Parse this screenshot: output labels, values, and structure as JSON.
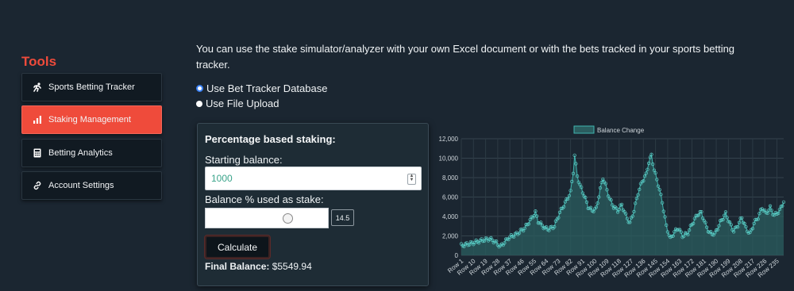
{
  "sidebar": {
    "title": "Tools",
    "items": [
      {
        "label": "Sports Betting Tracker",
        "icon": "running-icon",
        "active": false
      },
      {
        "label": "Staking Management",
        "icon": "bar-chart-icon",
        "active": true
      },
      {
        "label": "Betting Analytics",
        "icon": "calculator-icon",
        "active": false
      },
      {
        "label": "Account Settings",
        "icon": "link-icon",
        "active": false
      }
    ]
  },
  "main": {
    "intro": "You can use the stake simulator/analyzer with your own Excel document or with the bets tracked in your sports betting tracker.",
    "options": [
      {
        "label": "Use Bet Tracker Database",
        "checked": true
      },
      {
        "label": "Use File Upload",
        "checked": false
      }
    ],
    "panel": {
      "title": "Percentage based staking:",
      "starting_label": "Starting balance:",
      "starting_value": "1000",
      "stake_label": "Balance % used as stake:",
      "stake_value": "14.5",
      "stake_percent": 14.5,
      "calculate_label": "Calculate",
      "final_label": "Final Balance:",
      "final_value": "$5549.94"
    }
  },
  "colors": {
    "accent": "#ef4b3b",
    "chart_line": "#3fb5b0",
    "chart_fill": "#2b5d5f"
  },
  "chart_data": {
    "type": "line",
    "legend": "Balance Change",
    "legend_position": "top-center",
    "grid": true,
    "ylim": [
      0,
      12000
    ],
    "yticks": [
      "0",
      "2,000",
      "4,000",
      "6,000",
      "8,000",
      "10,000",
      "12,000"
    ],
    "xtick_labels": [
      "Row 1",
      "Row 10",
      "Row 19",
      "Row 28",
      "Row 37",
      "Row 46",
      "Row 55",
      "Row 64",
      "Row 73",
      "Row 82",
      "Row 91",
      "Row 100",
      "Row 109",
      "Row 118",
      "Row 127",
      "Row 136",
      "Row 145",
      "Row 154",
      "Row 163",
      "Row 172",
      "Row 181",
      "Row 190",
      "Row 199",
      "Row 208",
      "Row 217",
      "Row 226",
      "Row 235"
    ],
    "x_points": 240,
    "anchors": [
      [
        1,
        1000
      ],
      [
        10,
        1300
      ],
      [
        18,
        1600
      ],
      [
        22,
        1700
      ],
      [
        26,
        1400
      ],
      [
        30,
        900
      ],
      [
        36,
        1800
      ],
      [
        42,
        2200
      ],
      [
        48,
        2800
      ],
      [
        52,
        3600
      ],
      [
        56,
        4400
      ],
      [
        58,
        3500
      ],
      [
        63,
        2800
      ],
      [
        66,
        2700
      ],
      [
        70,
        3000
      ],
      [
        74,
        4400
      ],
      [
        78,
        5400
      ],
      [
        82,
        6500
      ],
      [
        84,
        8600
      ],
      [
        85,
        10300
      ],
      [
        87,
        8200
      ],
      [
        89,
        7200
      ],
      [
        92,
        6200
      ],
      [
        95,
        5000
      ],
      [
        98,
        4600
      ],
      [
        101,
        4800
      ],
      [
        104,
        6800
      ],
      [
        106,
        8000
      ],
      [
        108,
        7200
      ],
      [
        111,
        5800
      ],
      [
        114,
        5000
      ],
      [
        117,
        4600
      ],
      [
        120,
        5200
      ],
      [
        123,
        4100
      ],
      [
        126,
        3300
      ],
      [
        129,
        4600
      ],
      [
        132,
        6400
      ],
      [
        135,
        7600
      ],
      [
        138,
        8300
      ],
      [
        140,
        9600
      ],
      [
        142,
        10300
      ],
      [
        144,
        8800
      ],
      [
        147,
        7300
      ],
      [
        150,
        5500
      ],
      [
        153,
        3000
      ],
      [
        156,
        1700
      ],
      [
        159,
        2400
      ],
      [
        162,
        2800
      ],
      [
        165,
        2000
      ],
      [
        169,
        2300
      ],
      [
        172,
        3200
      ],
      [
        176,
        4200
      ],
      [
        179,
        4400
      ],
      [
        182,
        3200
      ],
      [
        185,
        2300
      ],
      [
        189,
        2200
      ],
      [
        193,
        3400
      ],
      [
        197,
        4300
      ],
      [
        200,
        3300
      ],
      [
        203,
        2500
      ],
      [
        206,
        3100
      ],
      [
        209,
        3900
      ],
      [
        212,
        2800
      ],
      [
        215,
        2200
      ],
      [
        218,
        3300
      ],
      [
        221,
        3900
      ],
      [
        224,
        4900
      ],
      [
        227,
        4300
      ],
      [
        230,
        4900
      ],
      [
        233,
        4100
      ],
      [
        237,
        4600
      ],
      [
        240,
        5550
      ]
    ]
  }
}
